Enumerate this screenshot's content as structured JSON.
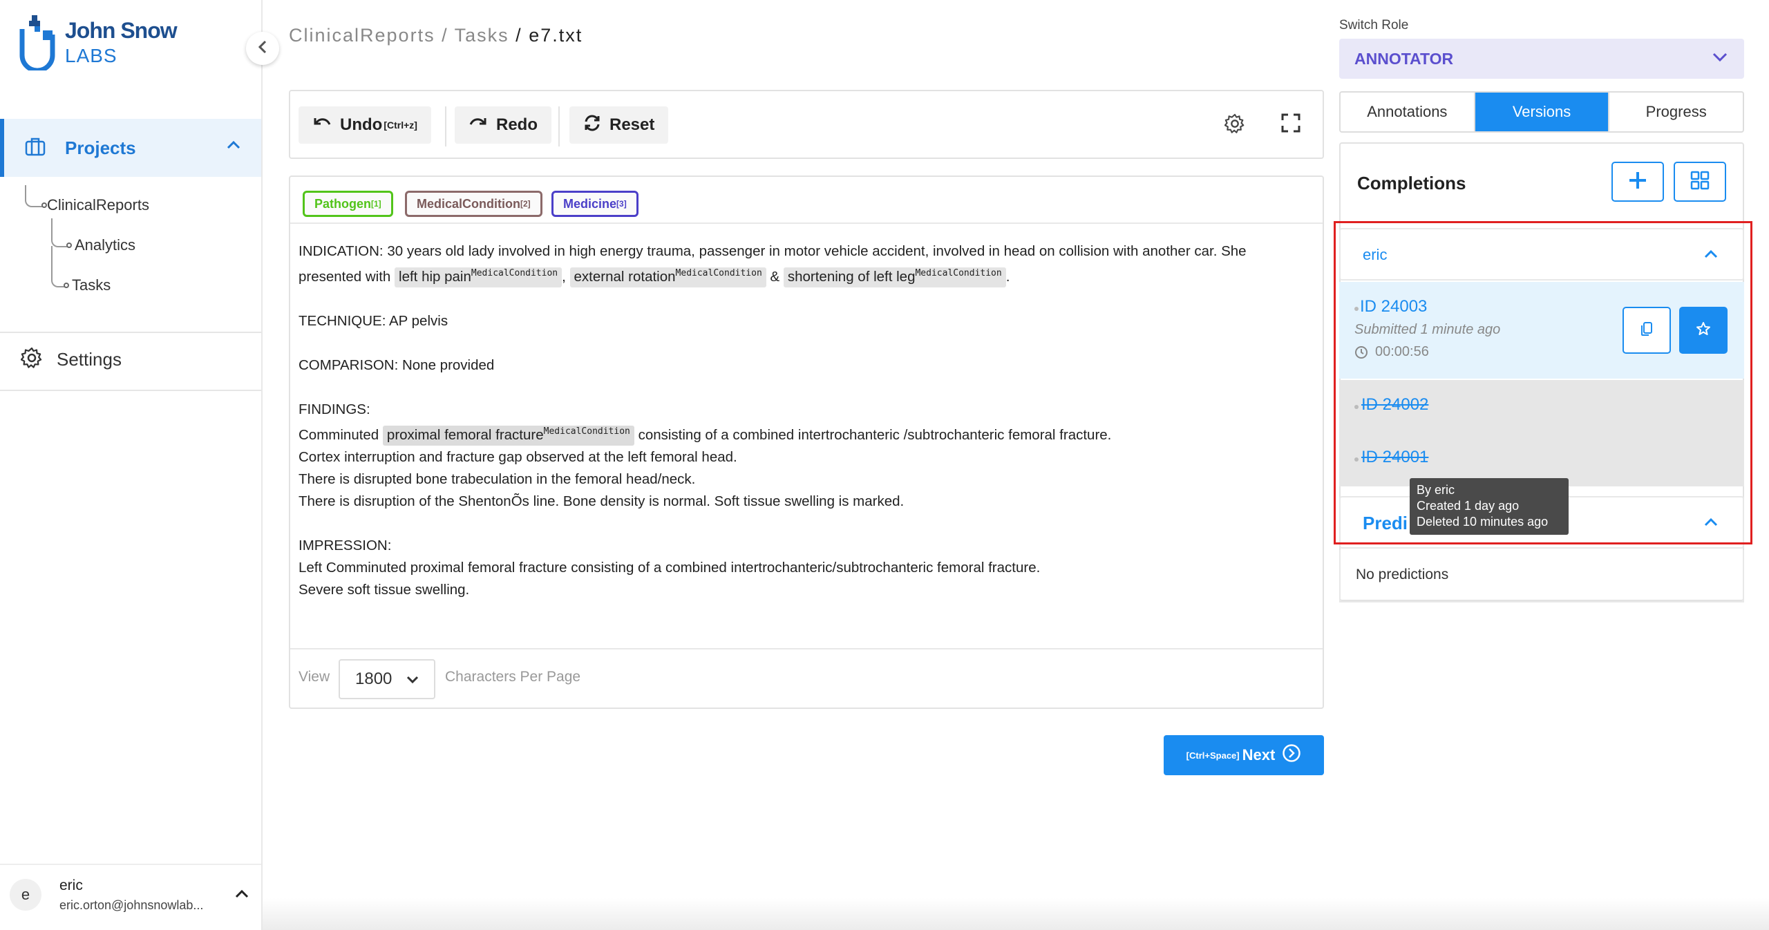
{
  "app": {
    "logo_line1": "John Snow",
    "logo_line2": "LABS"
  },
  "sidebar": {
    "projects_label": "Projects",
    "tree": {
      "project": "ClinicalReports",
      "analytics": "Analytics",
      "tasks": "Tasks"
    },
    "settings_label": "Settings",
    "user": {
      "initial": "e",
      "name": "eric",
      "email": "eric.orton@johnsnowlab..."
    }
  },
  "breadcrumb": {
    "part1": "ClinicalReports",
    "sep1": "/",
    "part2": "Tasks",
    "sep2": "/",
    "current": "e7.txt"
  },
  "toolbar": {
    "undo_label": "Undo",
    "undo_shortcut": "[Ctrl+z]",
    "redo_label": "Redo",
    "reset_label": "Reset"
  },
  "labels": [
    {
      "name": "Pathogen",
      "key": "[1]",
      "color": "#52c41a"
    },
    {
      "name": "MedicalCondition",
      "key": "[2]",
      "color": "#8c6a6a"
    },
    {
      "name": "Medicine",
      "key": "[3]",
      "color": "#4b3fc8"
    }
  ],
  "document": {
    "indication_a": "INDICATION: 30 years old lady involved in high energy trauma, passenger in motor vehicle accident, involved in head on collision with another car. She",
    "indication_b_pre": "presented with ",
    "ent1_text": "left hip pain",
    "ent_label": "MedicalCondition",
    "comma": ", ",
    "ent2_text": "external rotation",
    "amp": " & ",
    "ent3_text": "shortening of left leg",
    "period": ".",
    "technique": "TECHNIQUE: AP pelvis",
    "comparison": "COMPARISON: None provided",
    "findings_head": "FINDINGS:",
    "findings1_pre": "Comminuted ",
    "ent4_text": "proximal femoral fracture",
    "findings1_post": " consisting of a combined intertrochanteric /subtrochanteric femoral fracture.",
    "findings2": "Cortex interruption and fracture gap observed at the left femoral head.",
    "findings3": "There is disrupted bone trabeculation in the femoral head/neck.",
    "findings4": "There is disruption of the ShentonÕs line. Bone density is normal. Soft tissue swelling is marked.",
    "impression_head": "IMPRESSION:",
    "impression1": "Left Comminuted proximal femoral fracture consisting of a combined intertrochanteric/subtrochanteric femoral fracture.",
    "impression2": "Severe soft tissue swelling."
  },
  "pager": {
    "view_label": "View",
    "chars_value": "1800",
    "cpp_label": "Characters Per Page"
  },
  "next": {
    "shortcut": "[Ctrl+Space]",
    "label": "Next"
  },
  "right_panel": {
    "switch_role_label": "Switch Role",
    "role_value": "ANNOTATOR",
    "tabs": [
      "Annotations",
      "Versions",
      "Progress"
    ],
    "active_tab": "Versions",
    "completions_title": "Completions",
    "group_name": "eric",
    "active_completion": {
      "id": "ID 24003",
      "submitted": "Submitted 1 minute ago",
      "time": "00:00:56"
    },
    "deleted_completions": [
      "ID 24002",
      "ID 24001"
    ],
    "predictions_title": "Predi",
    "no_predictions": "No predictions",
    "tooltip": {
      "line1": "By eric",
      "line2": "Created 1 day ago",
      "line3": "Deleted 10 minutes ago"
    }
  },
  "colors": {
    "accent": "#1a8cf0",
    "brand": "#1e4f8f",
    "role": "#5b4fce",
    "highlight_box": "#e02020"
  }
}
